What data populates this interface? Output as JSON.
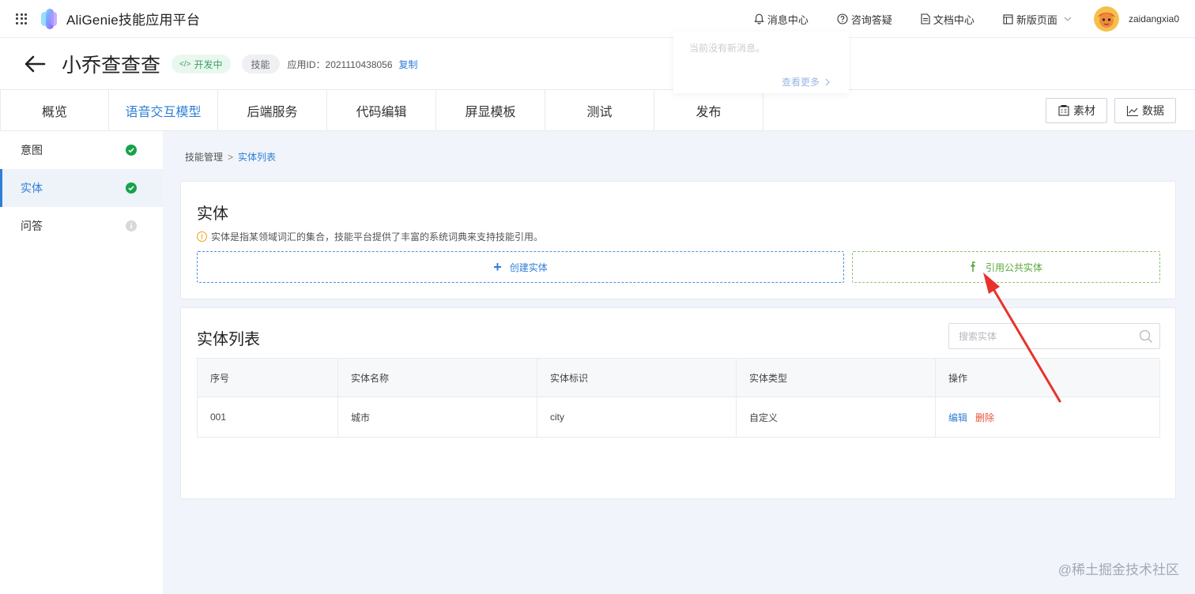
{
  "header": {
    "brand": "AliGenie技能应用平台",
    "links": {
      "messages": "消息中心",
      "consult": "咨询答疑",
      "docs": "文档中心",
      "new_page": "新版页面"
    },
    "username": "zaidangxia0"
  },
  "notification_popover": {
    "empty_text": "当前没有新消息。",
    "more_link": "查看更多"
  },
  "app": {
    "name": "小乔查查查",
    "status_tag": "开发中",
    "type_tag": "技能",
    "app_id_label": "应用ID：",
    "app_id": "2021110438056",
    "copy_label": "复制"
  },
  "tabs": [
    {
      "label": "概览",
      "active": false
    },
    {
      "label": "语音交互模型",
      "active": true
    },
    {
      "label": "后端服务",
      "active": false
    },
    {
      "label": "代码编辑",
      "active": false
    },
    {
      "label": "屏显模板",
      "active": false
    },
    {
      "label": "测试",
      "active": false
    },
    {
      "label": "发布",
      "active": false
    }
  ],
  "tools": {
    "material": "素材",
    "data": "数据"
  },
  "sidebar": {
    "items": [
      {
        "label": "意图",
        "status": "complete",
        "active": false
      },
      {
        "label": "实体",
        "status": "complete",
        "active": true
      },
      {
        "label": "问答",
        "status": "info",
        "active": false
      }
    ]
  },
  "breadcrumb": {
    "parent": "技能管理",
    "sep": ">",
    "current": "实体列表"
  },
  "entity_card": {
    "title": "实体",
    "tip": "实体是指某领域词汇的集合，技能平台提供了丰富的系统词典来支持技能引用。",
    "create_button": "创建实体",
    "reference_button": "引用公共实体"
  },
  "entity_list": {
    "title": "实体列表",
    "search_placeholder": "搜索实体",
    "columns": [
      "序号",
      "实体名称",
      "实体标识",
      "实体类型",
      "操作"
    ],
    "rows": [
      {
        "index": "001",
        "name": "城市",
        "identifier": "city",
        "type": "自定义",
        "edit": "编辑",
        "delete": "删除"
      }
    ]
  },
  "watermark": "@稀土掘金技术社区",
  "colors": {
    "accent": "#2f7fd6",
    "success": "#16a34a",
    "danger": "#e5533d",
    "reference_green": "#5aa83a",
    "annotation_arrow": "#e8322b"
  }
}
